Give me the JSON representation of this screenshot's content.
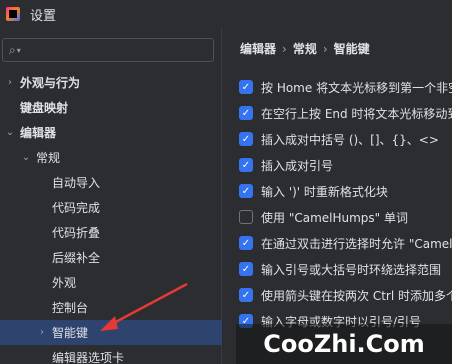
{
  "window": {
    "title": "设置"
  },
  "search": {
    "placeholder": "",
    "value": ""
  },
  "sidebar": {
    "items": [
      {
        "label": "外观与行为",
        "arrow": "›",
        "bold": true
      },
      {
        "label": "键盘映射",
        "arrow": "",
        "bold": true
      },
      {
        "label": "编辑器",
        "arrow": "⌄",
        "bold": true
      },
      {
        "label": "常规",
        "arrow": "⌄",
        "bold": false
      },
      {
        "label": "自动导入",
        "arrow": "",
        "bold": false
      },
      {
        "label": "代码完成",
        "arrow": "",
        "bold": false
      },
      {
        "label": "代码折叠",
        "arrow": "",
        "bold": false
      },
      {
        "label": "后缀补全",
        "arrow": "",
        "bold": false
      },
      {
        "label": "外观",
        "arrow": "",
        "bold": false
      },
      {
        "label": "控制台",
        "arrow": "",
        "bold": false
      },
      {
        "label": "智能键",
        "arrow": "›",
        "bold": false,
        "selected": true
      },
      {
        "label": "编辑器选项卡",
        "arrow": "",
        "bold": false
      }
    ]
  },
  "breadcrumb": {
    "level1": "编辑器",
    "level2": "常规",
    "level3": "智能键",
    "separator": "›"
  },
  "options": [
    {
      "label": "按 Home 将文本光标移到第一个非空",
      "checked": true
    },
    {
      "label": "在空行上按 End 时将文本光标移动到",
      "checked": true
    },
    {
      "label": "插入成对中括号 ()、[]、{}、<>",
      "checked": true
    },
    {
      "label": "插入成对引号",
      "checked": true
    },
    {
      "label": "输入 ')' 时重新格式化块",
      "checked": true
    },
    {
      "label": "使用 \"CamelHumps\" 单词",
      "checked": false
    },
    {
      "label": "在通过双击进行选择时允许 \"CamelH",
      "checked": true
    },
    {
      "label": "输入引号或大括号时环绕选择范围",
      "checked": true
    },
    {
      "label": "使用箭头键在按两次 Ctrl 时添加多个",
      "checked": true
    },
    {
      "label": "输入字母或数字时以引号/引号",
      "checked": true
    }
  ],
  "watermark": {
    "text": "CooZhi.Com"
  },
  "colors": {
    "accent": "#3574f0",
    "selection": "#2e436e",
    "annotation_arrow": "#e53935"
  }
}
